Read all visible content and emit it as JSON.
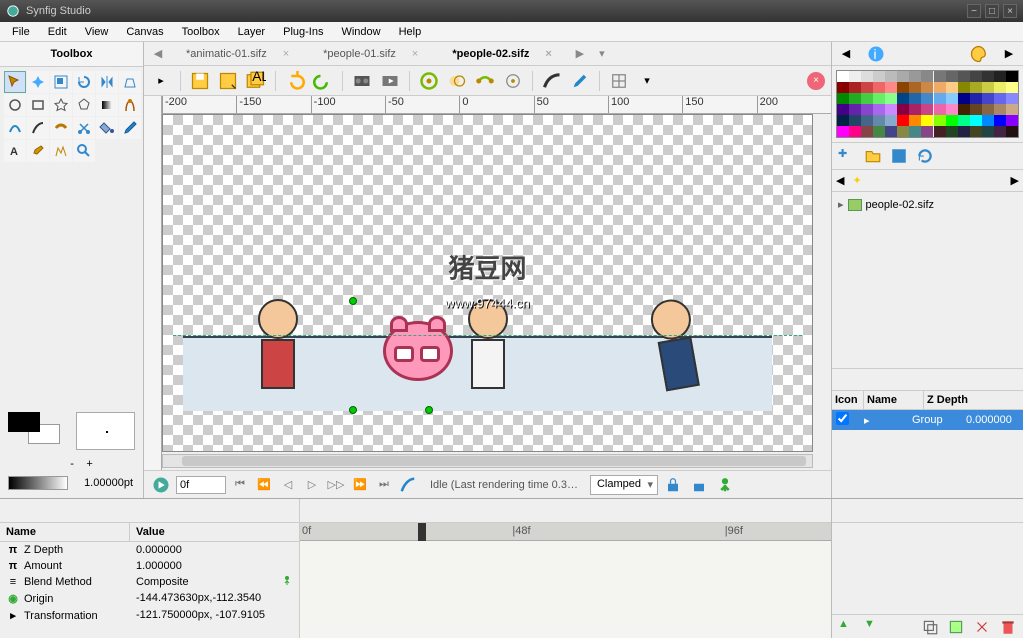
{
  "window": {
    "title": "Synfig Studio"
  },
  "menu": [
    "File",
    "Edit",
    "View",
    "Canvas",
    "Toolbox",
    "Layer",
    "Plug-Ins",
    "Window",
    "Help"
  ],
  "toolbox": {
    "title": "Toolbox",
    "pt_value": "1.00000pt",
    "minus": "-",
    "plus": "+"
  },
  "tabs": [
    {
      "label": "*animatic-01.sifz",
      "active": false
    },
    {
      "label": "*people-01.sifz",
      "active": false
    },
    {
      "label": "*people-02.sifz",
      "active": true
    }
  ],
  "ruler_ticks": [
    "-200",
    "-150",
    "-100",
    "-50",
    "0",
    "50",
    "100",
    "150",
    "200"
  ],
  "watermark": {
    "text": "猪豆网",
    "url": "www.97444.cn"
  },
  "playback": {
    "frame": "0f",
    "status": "Idle (Last rendering time 0.3…",
    "interp": "Clamped"
  },
  "layers": {
    "file": "people-02.sifz",
    "cols": [
      "Icon",
      "Name",
      "Z Depth"
    ],
    "row": {
      "name": "Group",
      "zdepth": "0.000000"
    }
  },
  "params": {
    "cols": [
      "Name",
      "Value"
    ],
    "rows": [
      {
        "icon": "π",
        "name": "Z Depth",
        "value": "0.000000"
      },
      {
        "icon": "π",
        "name": "Amount",
        "value": "1.000000"
      },
      {
        "icon": "≡",
        "name": "Blend Method",
        "value": "Composite"
      },
      {
        "icon": "◉",
        "name": "Origin",
        "value": "-144.473630px,-112.3540"
      },
      {
        "icon": "⬚",
        "name": "Transformation",
        "value": "-121.750000px, -107.9105"
      }
    ]
  },
  "timeline": {
    "marks": [
      {
        "label": "0f",
        "pos": 0
      },
      {
        "label": "|48f",
        "pos": 40
      },
      {
        "label": "|96f",
        "pos": 80
      }
    ]
  },
  "palette_colors": [
    "#fff",
    "#eee",
    "#ddd",
    "#ccc",
    "#bbb",
    "#aaa",
    "#999",
    "#888",
    "#777",
    "#666",
    "#555",
    "#444",
    "#333",
    "#222",
    "#000",
    "#800",
    "#a22",
    "#c44",
    "#e66",
    "#f88",
    "#840",
    "#a62",
    "#c84",
    "#ea6",
    "#fc8",
    "#880",
    "#aa2",
    "#cc4",
    "#ee6",
    "#ff8",
    "#080",
    "#2a2",
    "#4c4",
    "#6e6",
    "#8f8",
    "#048",
    "#26a",
    "#48c",
    "#6ae",
    "#8cf",
    "#008",
    "#22a",
    "#44c",
    "#66e",
    "#88f",
    "#408",
    "#62a",
    "#84c",
    "#a6e",
    "#c8f",
    "#804",
    "#a26",
    "#c48",
    "#e6a",
    "#f8c",
    "#420",
    "#642",
    "#864",
    "#a86",
    "#ca8",
    "#024",
    "#246",
    "#468",
    "#68a",
    "#8ac",
    "#f00",
    "#f80",
    "#ff0",
    "#8f0",
    "#0f0",
    "#0f8",
    "#0ff",
    "#08f",
    "#00f",
    "#80f",
    "#f0f",
    "#f08",
    "#844",
    "#484",
    "#448",
    "#884",
    "#488",
    "#848",
    "#422",
    "#242",
    "#224",
    "#442",
    "#244",
    "#424",
    "#211"
  ]
}
